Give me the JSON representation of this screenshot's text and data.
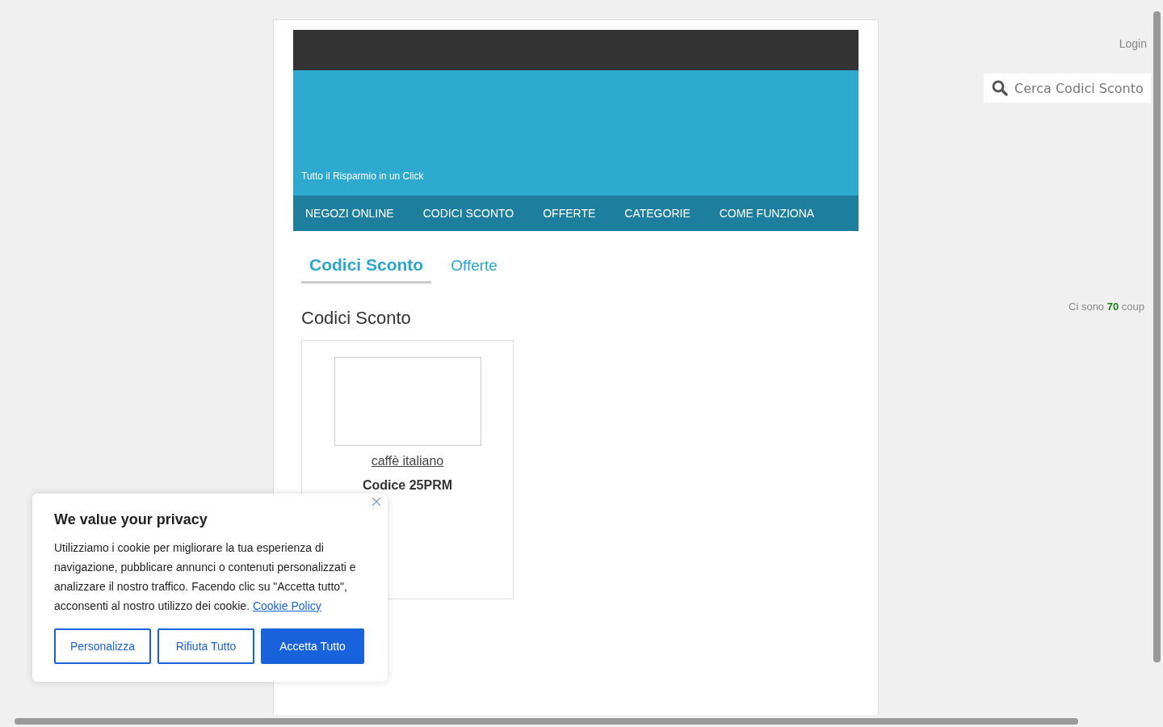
{
  "header": {
    "tagline": "Tutto il Risparmio in un Click"
  },
  "nav": {
    "items": [
      "NEGOZI ONLINE",
      "CODICI SCONTO",
      "OFFERTE",
      "CATEGORIE",
      "COME FUNZIONA"
    ]
  },
  "tabs": [
    {
      "label": "Codici Sconto",
      "selected": true
    },
    {
      "label": "Offerte",
      "selected": false
    }
  ],
  "section_title": "Codici Sconto",
  "coupons": [
    {
      "store": "caffè italiano",
      "code": "Codice 25PRM"
    }
  ],
  "sidebar": {
    "login": "Login",
    "search": {
      "placeholder": "Cerca Codici Sconto"
    },
    "count_text": "Ci sono **70** coup"
  },
  "cookie_banner": {
    "title": "We value your privacy",
    "text": "Utilizziamo i cookie per migliorare la tua esperienza di navigazione, pubblicare annunci o contenuti personalizzati e analizzare il nostro traffico. Facendo clic su \"Accetta tutto\", acconsenti al nostro utilizzo dei cookie.",
    "link": "Cookie Policy",
    "buttons": [
      {
        "label": "Personalizza",
        "kind": "outline"
      },
      {
        "label": "Rifiuta Tutto",
        "kind": "outline"
      },
      {
        "label": "Accetta Tutto",
        "kind": "primary"
      }
    ]
  }
}
